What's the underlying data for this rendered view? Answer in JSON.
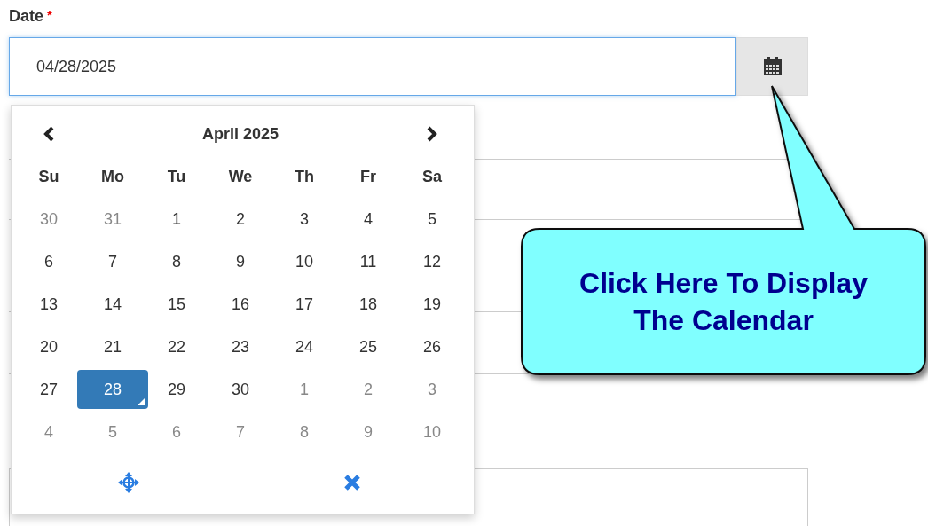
{
  "field": {
    "label": "Date",
    "required_mark": "*",
    "value": "04/28/2025"
  },
  "calendar": {
    "month": "April 2025",
    "weekdays": [
      "Su",
      "Mo",
      "Tu",
      "We",
      "Th",
      "Fr",
      "Sa"
    ],
    "weeks": [
      [
        {
          "day": "30",
          "muted": true,
          "selected": false
        },
        {
          "day": "31",
          "muted": true,
          "selected": false
        },
        {
          "day": "1",
          "muted": false,
          "selected": false
        },
        {
          "day": "2",
          "muted": false,
          "selected": false
        },
        {
          "day": "3",
          "muted": false,
          "selected": false
        },
        {
          "day": "4",
          "muted": false,
          "selected": false
        },
        {
          "day": "5",
          "muted": false,
          "selected": false
        }
      ],
      [
        {
          "day": "6",
          "muted": false,
          "selected": false
        },
        {
          "day": "7",
          "muted": false,
          "selected": false
        },
        {
          "day": "8",
          "muted": false,
          "selected": false
        },
        {
          "day": "9",
          "muted": false,
          "selected": false
        },
        {
          "day": "10",
          "muted": false,
          "selected": false
        },
        {
          "day": "11",
          "muted": false,
          "selected": false
        },
        {
          "day": "12",
          "muted": false,
          "selected": false
        }
      ],
      [
        {
          "day": "13",
          "muted": false,
          "selected": false
        },
        {
          "day": "14",
          "muted": false,
          "selected": false
        },
        {
          "day": "15",
          "muted": false,
          "selected": false
        },
        {
          "day": "16",
          "muted": false,
          "selected": false
        },
        {
          "day": "17",
          "muted": false,
          "selected": false
        },
        {
          "day": "18",
          "muted": false,
          "selected": false
        },
        {
          "day": "19",
          "muted": false,
          "selected": false
        }
      ],
      [
        {
          "day": "20",
          "muted": false,
          "selected": false
        },
        {
          "day": "21",
          "muted": false,
          "selected": false
        },
        {
          "day": "22",
          "muted": false,
          "selected": false
        },
        {
          "day": "23",
          "muted": false,
          "selected": false
        },
        {
          "day": "24",
          "muted": false,
          "selected": false
        },
        {
          "day": "25",
          "muted": false,
          "selected": false
        },
        {
          "day": "26",
          "muted": false,
          "selected": false
        }
      ],
      [
        {
          "day": "27",
          "muted": false,
          "selected": false
        },
        {
          "day": "28",
          "muted": false,
          "selected": true
        },
        {
          "day": "29",
          "muted": false,
          "selected": false
        },
        {
          "day": "30",
          "muted": false,
          "selected": false
        },
        {
          "day": "1",
          "muted": true,
          "selected": false
        },
        {
          "day": "2",
          "muted": true,
          "selected": false
        },
        {
          "day": "3",
          "muted": true,
          "selected": false
        }
      ],
      [
        {
          "day": "4",
          "muted": true,
          "selected": false
        },
        {
          "day": "5",
          "muted": true,
          "selected": false
        },
        {
          "day": "6",
          "muted": true,
          "selected": false
        },
        {
          "day": "7",
          "muted": true,
          "selected": false
        },
        {
          "day": "8",
          "muted": true,
          "selected": false
        },
        {
          "day": "9",
          "muted": true,
          "selected": false
        },
        {
          "day": "10",
          "muted": true,
          "selected": false
        }
      ]
    ]
  },
  "callout": {
    "text": "Click Here To Display The Calendar"
  }
}
